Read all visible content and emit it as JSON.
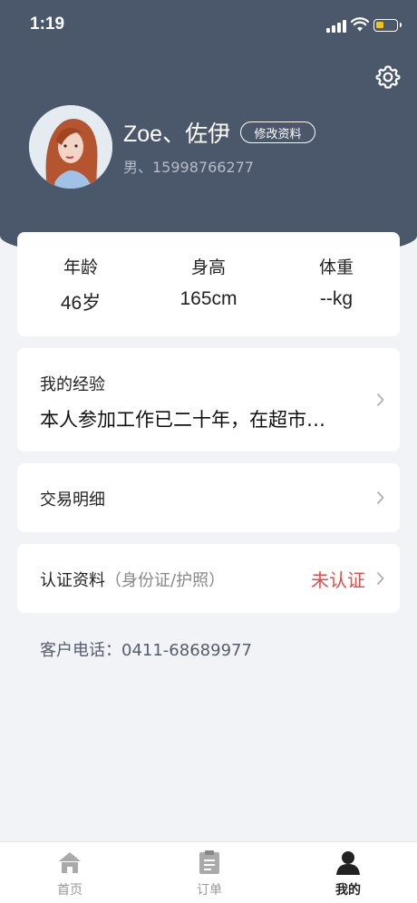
{
  "status_bar": {
    "time": "1:19",
    "battery_level": 0.4,
    "battery_color": "#f0c419"
  },
  "icons": {
    "settings": "gear-icon",
    "signal": "signal-icon",
    "wifi": "wifi-icon",
    "battery": "battery-icon",
    "chevron": "chevron-right-icon",
    "home": "home-icon",
    "orders": "document-icon",
    "profile": "person-icon"
  },
  "profile": {
    "name": "Zoe、佐伊",
    "edit_label": "修改资料",
    "sub": "男、15998766277"
  },
  "stats": [
    {
      "label": "年龄",
      "value": "46岁"
    },
    {
      "label": "身高",
      "value": "165cm"
    },
    {
      "label": "体重",
      "value": "--kg"
    }
  ],
  "experience": {
    "title": "我的经验",
    "text": "本人参加工作已二十年，在超市…"
  },
  "transactions": {
    "label": "交易明细"
  },
  "certification": {
    "label": "认证资料",
    "hint": "（身份证/护照）",
    "status": "未认证",
    "status_color": "#e24a4a"
  },
  "contact": {
    "phone_text": "客户电话：0411-68689977"
  },
  "tabs": [
    {
      "label": "首页",
      "active": false
    },
    {
      "label": "订单",
      "active": false
    },
    {
      "label": "我的",
      "active": true
    }
  ],
  "colors": {
    "header": "#4b576b",
    "background": "#f2f3f7",
    "accent_red": "#e24a4a"
  }
}
